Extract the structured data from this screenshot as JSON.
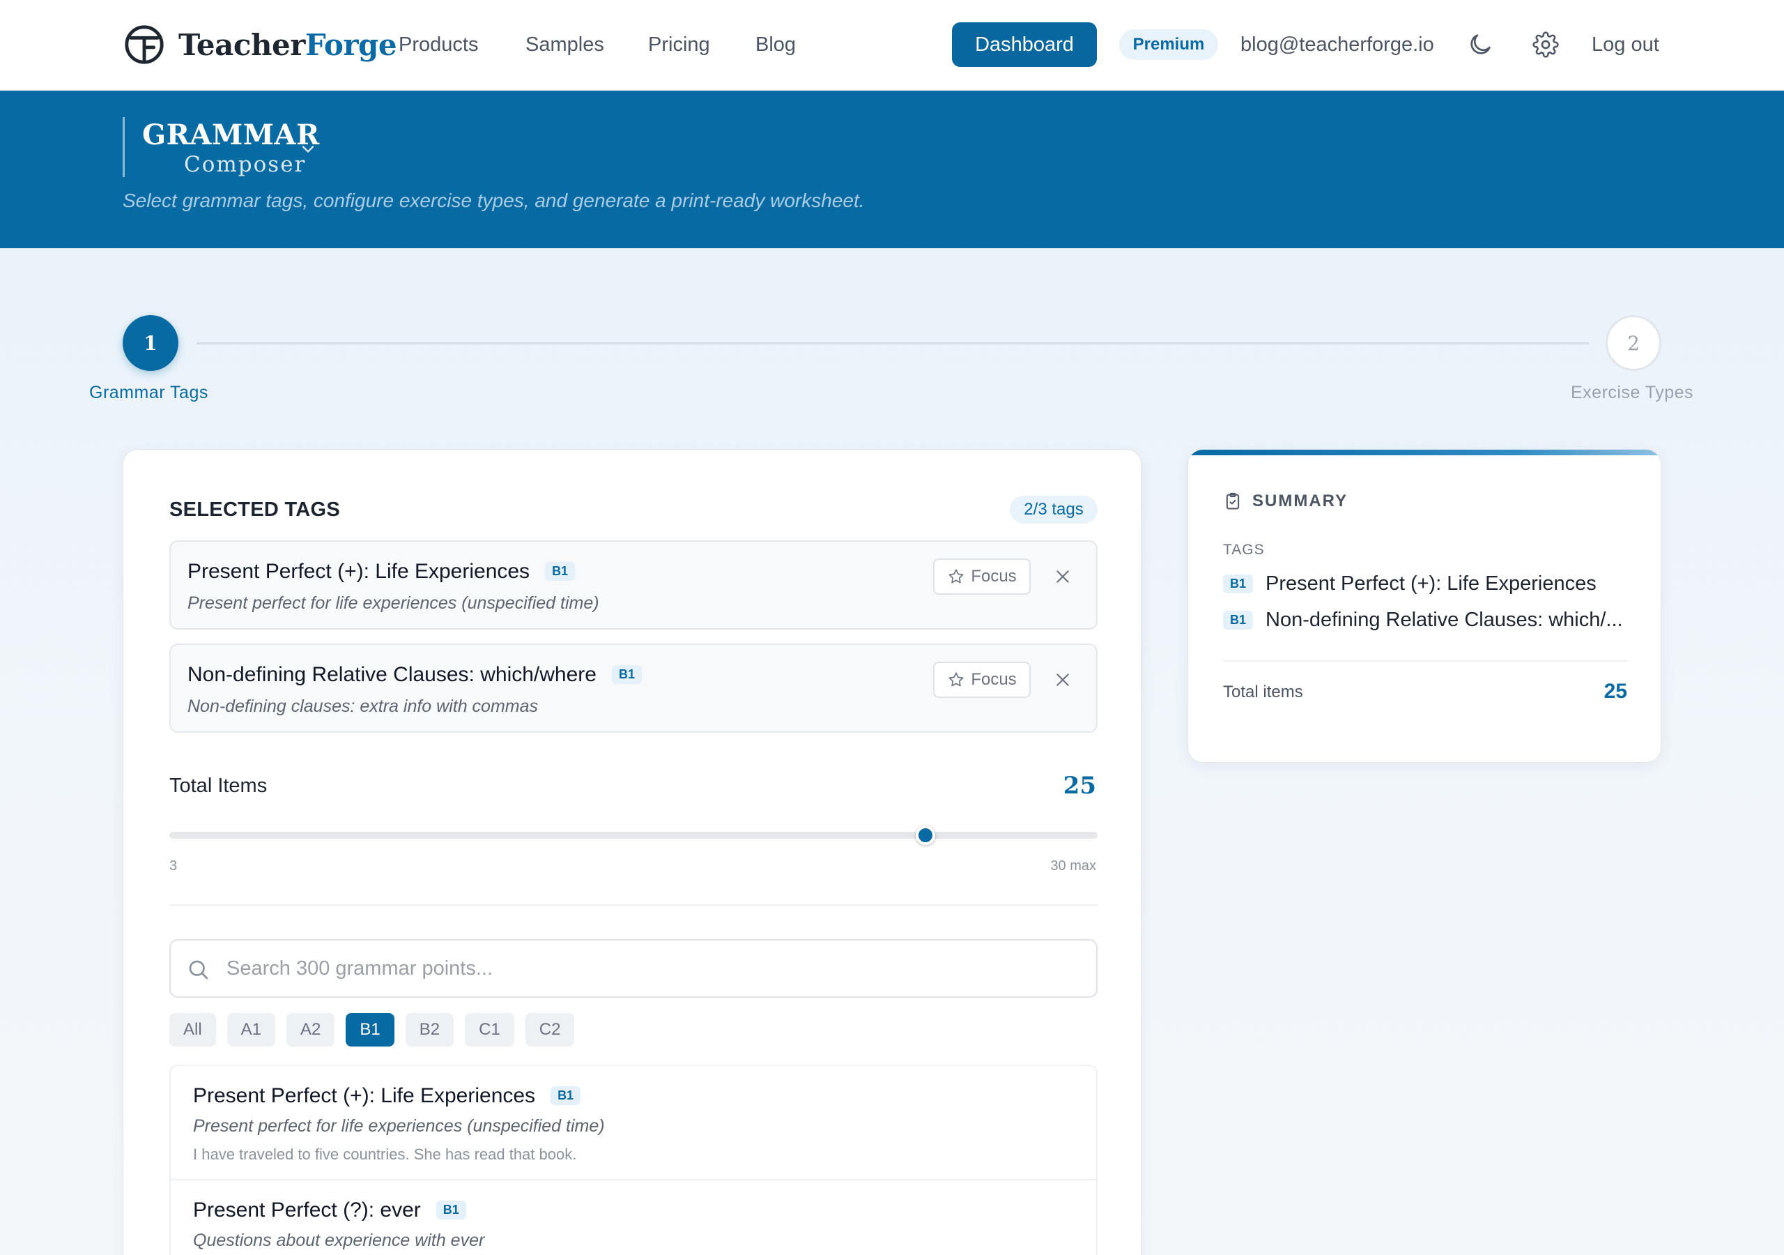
{
  "nav": {
    "logo_part1": "Teacher",
    "logo_part2": "Forge",
    "links": [
      "Products",
      "Samples",
      "Pricing",
      "Blog"
    ],
    "dashboard_label": "Dashboard",
    "premium_label": "Premium",
    "email": "blog@teacherforge.io",
    "theme_icon": "moon-icon",
    "settings_icon": "gear-icon",
    "logout_label": "Log out"
  },
  "hero": {
    "title": "GRAMMAR",
    "subtitle": "Composer",
    "description": "Select grammar tags, configure exercise types, and generate a print-ready worksheet."
  },
  "stepper": {
    "steps": [
      {
        "number": "1",
        "label": "Grammar Tags",
        "state": "active"
      },
      {
        "number": "2",
        "label": "Exercise Types",
        "state": "inactive"
      }
    ]
  },
  "selected": {
    "heading": "SELECTED TAGS",
    "count_label": "2/3 tags",
    "focus_label": "Focus",
    "tags": [
      {
        "title": "Present Perfect (+): Life Experiences",
        "level": "B1",
        "description": "Present perfect for life experiences (unspecified time)"
      },
      {
        "title": "Non-defining Relative Clauses: which/where",
        "level": "B1",
        "description": "Non-defining clauses: extra info with commas"
      }
    ]
  },
  "items": {
    "label": "Total Items",
    "value": "25",
    "current": 25,
    "min_label": "3",
    "max_label": "30 max",
    "min": 3,
    "max": 30
  },
  "search": {
    "placeholder": "Search 300 grammar points..."
  },
  "filters": {
    "levels": [
      "All",
      "A1",
      "A2",
      "B1",
      "B2",
      "C1",
      "C2"
    ],
    "active": "B1"
  },
  "results": [
    {
      "title": "Present Perfect (+): Life Experiences",
      "level": "B1",
      "description": "Present perfect for life experiences (unspecified time)",
      "example": "I have traveled to five countries. She has read that book."
    },
    {
      "title": "Present Perfect (?): ever",
      "level": "B1",
      "description": "Questions about experience with ever",
      "example": ""
    }
  ],
  "summary": {
    "heading": "SUMMARY",
    "tags_label": "TAGS",
    "tags": [
      {
        "level": "B1",
        "title": "Present Perfect (+): Life Experiences"
      },
      {
        "level": "B1",
        "title": "Non-defining Relative Clauses: which/..."
      }
    ],
    "total_label": "Total items",
    "total_value": "25"
  },
  "colors": {
    "primary": "#086aa3",
    "hero_bg": "#086aa3",
    "page_bg": "#e6f0f9",
    "badge_bg": "#e5f1fa"
  }
}
